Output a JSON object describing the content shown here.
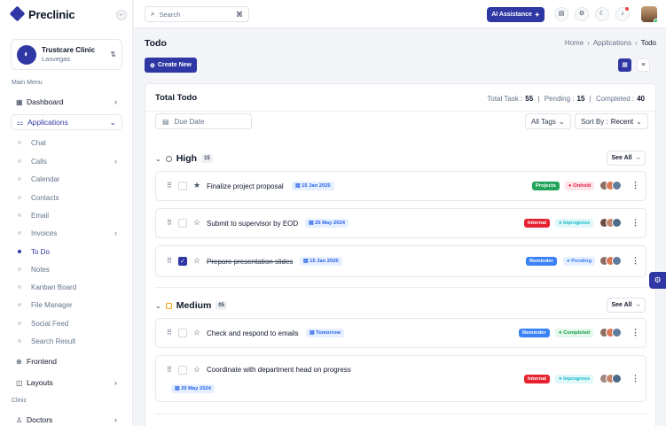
{
  "app": {
    "logo_text": "Preclinic"
  },
  "clinic": {
    "name": "Trustcare Clinic",
    "location": "Lasvegas"
  },
  "sidebar": {
    "section_main": "Main Menu",
    "dashboard": "Dashboard",
    "applications": "Applications",
    "app_items": [
      "Chat",
      "Calls",
      "Calendar",
      "Contacts",
      "Email",
      "Invoices",
      "To Do",
      "Notes",
      "Kanban Board",
      "File Manager",
      "Social Feed",
      "Search Result"
    ],
    "frontend": "Frontend",
    "layouts": "Layouts",
    "section_clinic": "Clinic",
    "doctors": "Doctors"
  },
  "topbar": {
    "search_placeholder": "Search",
    "ai_label": "AI Assistance"
  },
  "page": {
    "title": "Todo",
    "breadcrumb": [
      "Home",
      "Applications",
      "Todo"
    ],
    "create_label": "Create New"
  },
  "card": {
    "title": "Total Todo",
    "total_label": "Total Task :",
    "total_value": "55",
    "pending_label": "Pending :",
    "pending_value": "15",
    "completed_label": "Completed :",
    "completed_value": "40",
    "due_placeholder": "Due Date",
    "tags_label": "All Tags",
    "sort_label": "Sort By :",
    "sort_value": "Recent"
  },
  "groups": [
    {
      "name": "High",
      "count": "15",
      "see_all": "See All",
      "tasks": [
        {
          "title": "Finalize project proposal",
          "date": "15 Jan 2025",
          "tag": "Projects",
          "status": "Onhold",
          "checked": false
        },
        {
          "title": "Submit to supervisor by EOD",
          "date": "25 May 2024",
          "tag": "Internal",
          "status": "Inprogress",
          "checked": false
        },
        {
          "title": "Prepare presentation slides",
          "date": "15 Jan 2025",
          "tag": "Reminder",
          "status": "Pending",
          "checked": true
        }
      ]
    },
    {
      "name": "Medium",
      "count": "05",
      "see_all": "See All",
      "tasks": [
        {
          "title": "Check and respond to emails",
          "date": "Tomorrow",
          "tag": "Reminder",
          "status": "Completed",
          "checked": false
        },
        {
          "title": "Coordinate with department head on progress",
          "date": "25 May 2024",
          "tag": "Internal",
          "status": "Inprogress",
          "checked": false
        }
      ]
    }
  ],
  "colors": {
    "primary": "#2e37a4",
    "tag_projects": "#22a55b",
    "tag_internal": "#e5222f",
    "tag_reminder": "#3b82f6",
    "status_onhold": "#e11d48",
    "status_inprogress": "#14b8c8",
    "status_pending": "#3b82f6",
    "status_completed": "#16a34a"
  }
}
